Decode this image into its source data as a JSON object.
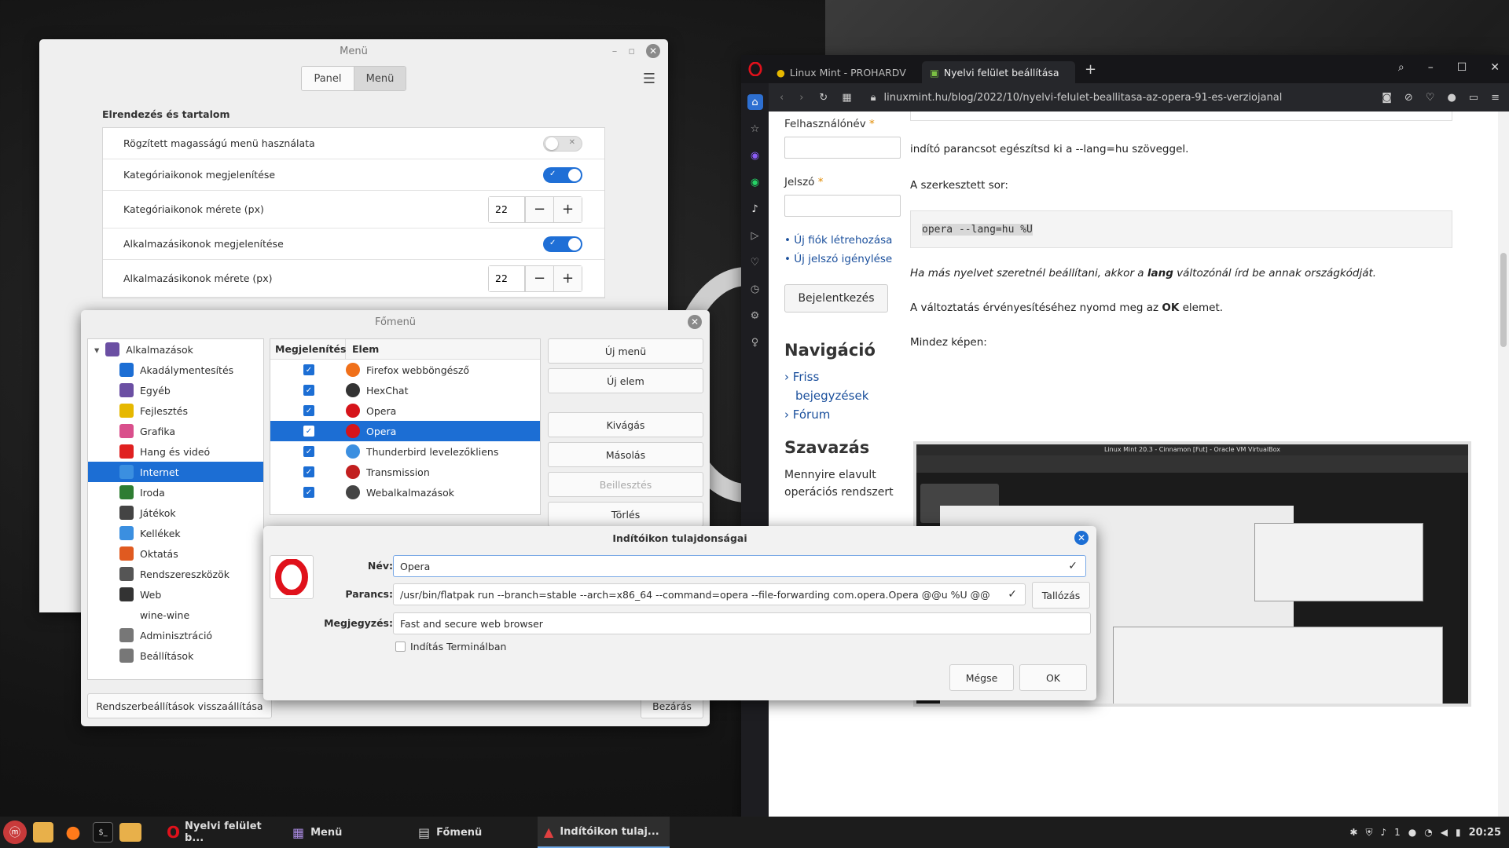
{
  "menu_settings": {
    "title": "Menü",
    "tabs": [
      "Panel",
      "Menü"
    ],
    "section": "Elrendezés és tartalom",
    "rows": [
      {
        "label": "Rögzített magasságú menü használata",
        "type": "toggle",
        "on": false
      },
      {
        "label": "Kategóriaikonok megjelenítése",
        "type": "toggle",
        "on": true
      },
      {
        "label": "Kategóriaikonok mérete (px)",
        "type": "spin",
        "value": "22"
      },
      {
        "label": "Alkalmazásikonok megjelenítése",
        "type": "toggle",
        "on": true
      },
      {
        "label": "Alkalmazásikonok mérete (px)",
        "type": "spin",
        "value": "22"
      }
    ]
  },
  "fomenu": {
    "title": "Főmenü",
    "tree": [
      {
        "label": "Alkalmazások",
        "color": "#6b4fa3",
        "root": true
      },
      {
        "label": "Akadálymentesítés",
        "color": "#1c6ed4"
      },
      {
        "label": "Egyéb",
        "color": "#6b4fa3"
      },
      {
        "label": "Fejlesztés",
        "color": "#e6b800"
      },
      {
        "label": "Grafika",
        "color": "#d94f8c"
      },
      {
        "label": "Hang és videó",
        "color": "#e02020"
      },
      {
        "label": "Internet",
        "color": "#3b8fe0",
        "selected": true
      },
      {
        "label": "Iroda",
        "color": "#2e7d32"
      },
      {
        "label": "Játékok",
        "color": "#444"
      },
      {
        "label": "Kellékek",
        "color": "#3b8fe0"
      },
      {
        "label": "Oktatás",
        "color": "#e05a20"
      },
      {
        "label": "Rendszereszközök",
        "color": "#555"
      },
      {
        "label": "Web",
        "color": "#333"
      },
      {
        "label": "wine-wine",
        "noicon": true
      },
      {
        "label": "Adminisztráció",
        "color": "#777"
      },
      {
        "label": "Beállítások",
        "color": "#777"
      }
    ],
    "list_headers": [
      "Megjelenítés",
      "Elem"
    ],
    "items": [
      {
        "label": "Firefox webböngésző",
        "color": "#f0701a"
      },
      {
        "label": "HexChat",
        "color": "#333"
      },
      {
        "label": "Opera",
        "color": "#d6141a"
      },
      {
        "label": "Opera",
        "color": "#d6141a",
        "selected": true
      },
      {
        "label": "Thunderbird levelezőkliens",
        "color": "#3b8fe0"
      },
      {
        "label": "Transmission",
        "color": "#c21f1f"
      },
      {
        "label": "Webalkalmazások",
        "color": "#444"
      }
    ],
    "buttons": [
      "Új menü",
      "Új elem",
      "Kivágás",
      "Másolás",
      "Beillesztés",
      "Törlés"
    ],
    "reset": "Rendszerbeállítások visszaállítása",
    "close": "Bezárás"
  },
  "props": {
    "title": "Indítóikon tulajdonságai",
    "name_label": "Név:",
    "name_value": "Opera",
    "cmd_label": "Parancs:",
    "cmd_value": "/usr/bin/flatpak run --branch=stable --arch=x86_64 --command=opera --file-forwarding com.opera.Opera @@u %U @@",
    "browse": "Tallózás",
    "note_label": "Megjegyzés:",
    "note_value": "Fast and secure web browser",
    "terminal": "Indítás Terminálban",
    "cancel": "Mégse",
    "ok": "OK"
  },
  "browser": {
    "tabs": [
      "Linux Mint - PROHARDV",
      "Nyelvi felület beállítása"
    ],
    "url": "linuxmint.hu/blog/2022/10/nyelvi-felulet-beallitasa-az-opera-91-es-verziojanal",
    "left": {
      "user_label": "Felhasználónév",
      "pass_label": "Jelszó",
      "links": [
        "Új fiók létrehozása",
        "Új jelszó igénylése"
      ],
      "login": "Bejelentkezés",
      "nav_title": "Navigáció",
      "nav_links": [
        "Friss",
        "bejegyzések",
        "Fórum"
      ],
      "vote_title": "Szavazás",
      "vote_text1": "Mennyire elavult",
      "vote_text2": "operációs rendszert"
    },
    "main": {
      "p1": "indító parancsot egészítsd ki a --lang=hu szöveggel.",
      "p2": "A szerkesztett sor:",
      "code": "opera --lang=hu %U",
      "p3_a": "Ha más nyelvet szeretnél beállítani, akkor a",
      "p3_b": "lang",
      "p3_c": "változónál írd be annak országkódját.",
      "p4_a": "A változtatás érvényesítéséhez nyomd meg az",
      "p4_b": "OK",
      "p4_c": "elemet.",
      "p5": "Mindez képen:"
    },
    "shot_title": "Linux Mint 20.3 - Cinnamon [Fut] - Oracle VM VirtualBox"
  },
  "taskbar": {
    "items": [
      "Nyelvi felület b...",
      "Menü",
      "Főmenü",
      "Indítóikon tulaj..."
    ],
    "clock": "20:25",
    "tray_count": "1"
  }
}
